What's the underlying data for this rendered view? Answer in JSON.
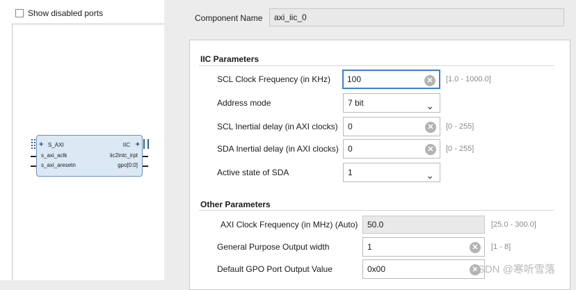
{
  "left": {
    "show_disabled_ports_label": "Show disabled ports",
    "block": {
      "left_ports": [
        "S_AXI",
        "s_axi_aclk",
        "s_axi_aresetn"
      ],
      "right_ports": [
        "IIC",
        "iic2intc_irpt",
        "gpo[0:0]"
      ]
    }
  },
  "component": {
    "label": "Component Name",
    "value": "axi_iic_0"
  },
  "iic_section": {
    "title": "IIC Parameters",
    "params": [
      {
        "label": "SCL Clock Frequency (in KHz)",
        "value": "100",
        "range": "[1.0 - 1000.0]"
      },
      {
        "label": "Address mode",
        "value": "7 bit"
      },
      {
        "label": "SCL Inertial delay (in AXI clocks)",
        "value": "0",
        "range": "[0 - 255]"
      },
      {
        "label": "SDA Inertial delay (in AXI clocks)",
        "value": "0",
        "range": "[0 - 255]"
      },
      {
        "label": "Active state of SDA",
        "value": "1"
      }
    ]
  },
  "other_section": {
    "title": "Other Parameters",
    "params": [
      {
        "label": "AXI Clock Frequency (in MHz) (Auto)",
        "value": "50.0",
        "range": "[25.0 - 300.0]"
      },
      {
        "label": "General Purpose Output width",
        "value": "1",
        "range": "[1 - 8]"
      },
      {
        "label": "Default GPO Port Output Value",
        "value": "0x00"
      }
    ]
  },
  "icons": {
    "clear": "clear-x-icon",
    "dropdown": "chevron-down-icon",
    "add": "plus-icon"
  },
  "colors": {
    "focus_border": "#3b7fd4",
    "block_fill": "#dbe9f5"
  },
  "watermark": "CSDN @寒听雪落"
}
